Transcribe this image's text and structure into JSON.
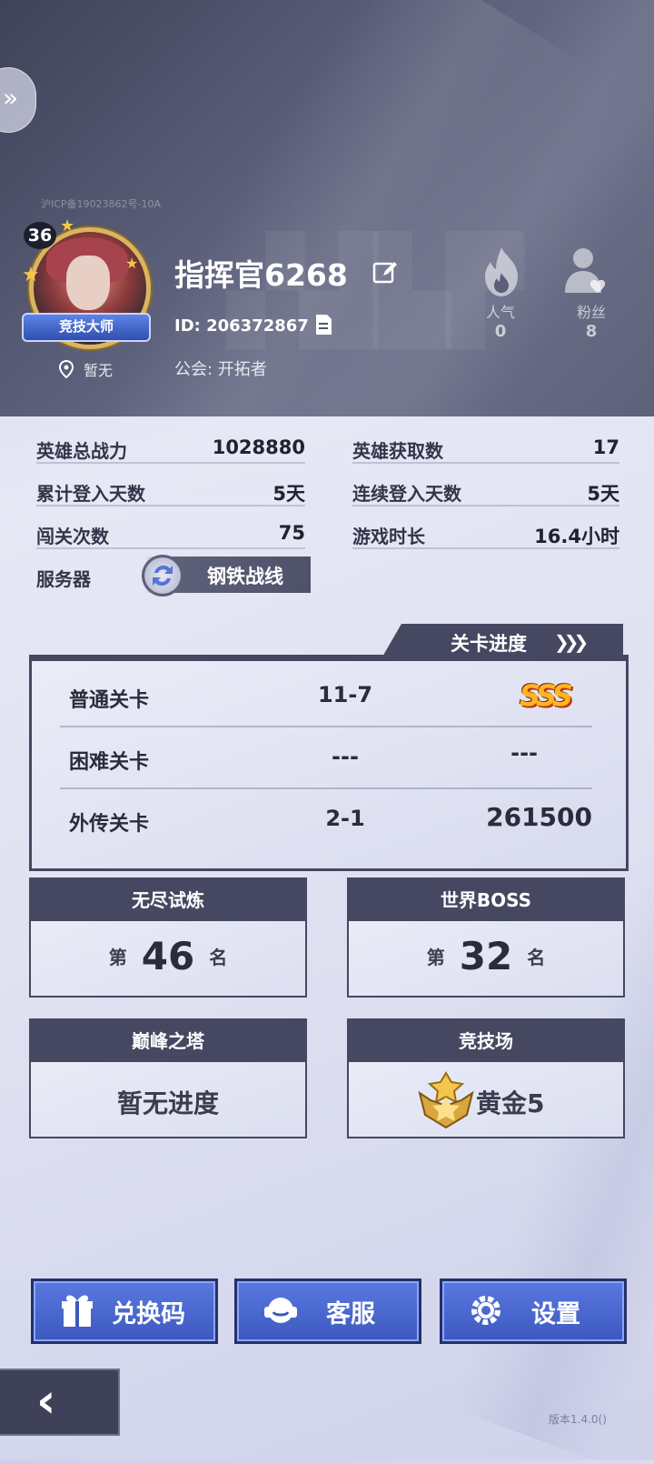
{
  "header": {
    "icp": "沪ICP备19023862号-10A",
    "level": "36",
    "rank_badge": "竞技大师",
    "location": "暂无",
    "name": "指挥官6268",
    "uid": "ID: 206372867",
    "guild": "公会: 开拓者",
    "popularity_label": "人气",
    "popularity_value": "0",
    "fans_label": "粉丝",
    "fans_value": "8"
  },
  "info": {
    "hero_power_label": "英雄总战力",
    "hero_power_value": "1028880",
    "heroes_owned_label": "英雄获取数",
    "heroes_owned_value": "17",
    "login_days_label": "累计登入天数",
    "login_days_value": "5天",
    "streak_days_label": "连续登入天数",
    "streak_days_value": "5天",
    "stages_cleared_label": "闯关次数",
    "stages_cleared_value": "75",
    "playtime_label": "游戏时长",
    "playtime_value": "16.4小时",
    "server_label": "服务器",
    "server_value": "钢铁战线"
  },
  "progress": {
    "title": "关卡进度",
    "rows": [
      {
        "label": "普通关卡",
        "stage": "11-7",
        "result": "SSS"
      },
      {
        "label": "困难关卡",
        "stage": "---",
        "result": "---"
      },
      {
        "label": "外传关卡",
        "stage": "2-1",
        "result": "261500"
      }
    ]
  },
  "cards": {
    "endless": {
      "title": "无尽试炼",
      "prefix": "第",
      "rank": "46",
      "suffix": "名"
    },
    "boss": {
      "title": "世界BOSS",
      "prefix": "第",
      "rank": "32",
      "suffix": "名"
    },
    "tower": {
      "title": "巅峰之塔",
      "text": "暂无进度"
    },
    "arena": {
      "title": "竞技场",
      "text": "黄金5"
    }
  },
  "buttons": {
    "redeem": "兑换码",
    "support": "客服",
    "settings": "设置"
  },
  "version": "版本1.4.0()",
  "colors": {
    "header_bg": "#4f536c",
    "panel_dark": "#454860",
    "button_blue": "#4a68d0",
    "gold": "#f4c64b"
  }
}
